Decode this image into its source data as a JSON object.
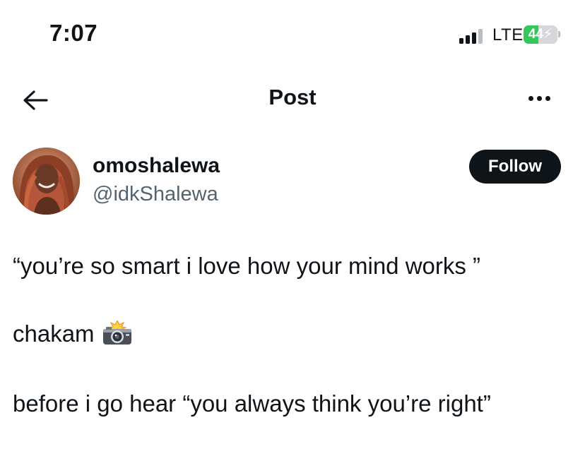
{
  "status_bar": {
    "time": "7:07",
    "network": "LTE",
    "battery_level": "44",
    "battery_fraction": 0.44
  },
  "nav": {
    "back_icon": "arrow-left-icon",
    "title": "Post",
    "more_icon": "more-horizontal-icon"
  },
  "author": {
    "display_name": "omoshalewa",
    "handle": "@idkShalewa",
    "follow_label": "Follow"
  },
  "post": {
    "lines": [
      "“you’re so smart i love how your mind works ”",
      "chakam",
      "before i go hear “you always think you’re right”"
    ],
    "emoji_icon": "camera-with-flash-icon"
  },
  "colors": {
    "text": "#0f1419",
    "secondary_text": "#536471",
    "follow_button_bg": "#0f1419",
    "battery_green": "#34c759"
  }
}
